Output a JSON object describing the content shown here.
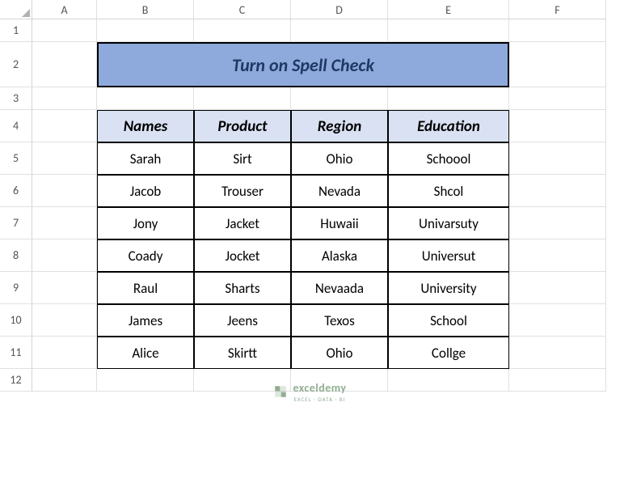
{
  "columns": [
    "A",
    "B",
    "C",
    "D",
    "E",
    "F"
  ],
  "rows": [
    "1",
    "2",
    "3",
    "4",
    "5",
    "6",
    "7",
    "8",
    "9",
    "10",
    "11",
    "12"
  ],
  "title": "Turn on Spell Check",
  "headers": [
    "Names",
    "Product",
    "Region",
    "Education"
  ],
  "table": [
    [
      "Sarah",
      "Sirt",
      "Ohio",
      "Schoool"
    ],
    [
      "Jacob",
      "Trouser",
      "Nevada",
      "Shcol"
    ],
    [
      "Jony",
      "Jacket",
      "Huwaii",
      "Univarsuty"
    ],
    [
      "Coady",
      "Jocket",
      "Alaska",
      "Universut"
    ],
    [
      "Raul",
      "Sharts",
      "Nevaada",
      "University"
    ],
    [
      "James",
      "Jeens",
      "Texos",
      "School"
    ],
    [
      "Alice",
      "Skirtt",
      "Ohio",
      "Collge"
    ]
  ],
  "watermark": {
    "main": "exceldemy",
    "sub": "EXCEL · DATA · BI"
  }
}
